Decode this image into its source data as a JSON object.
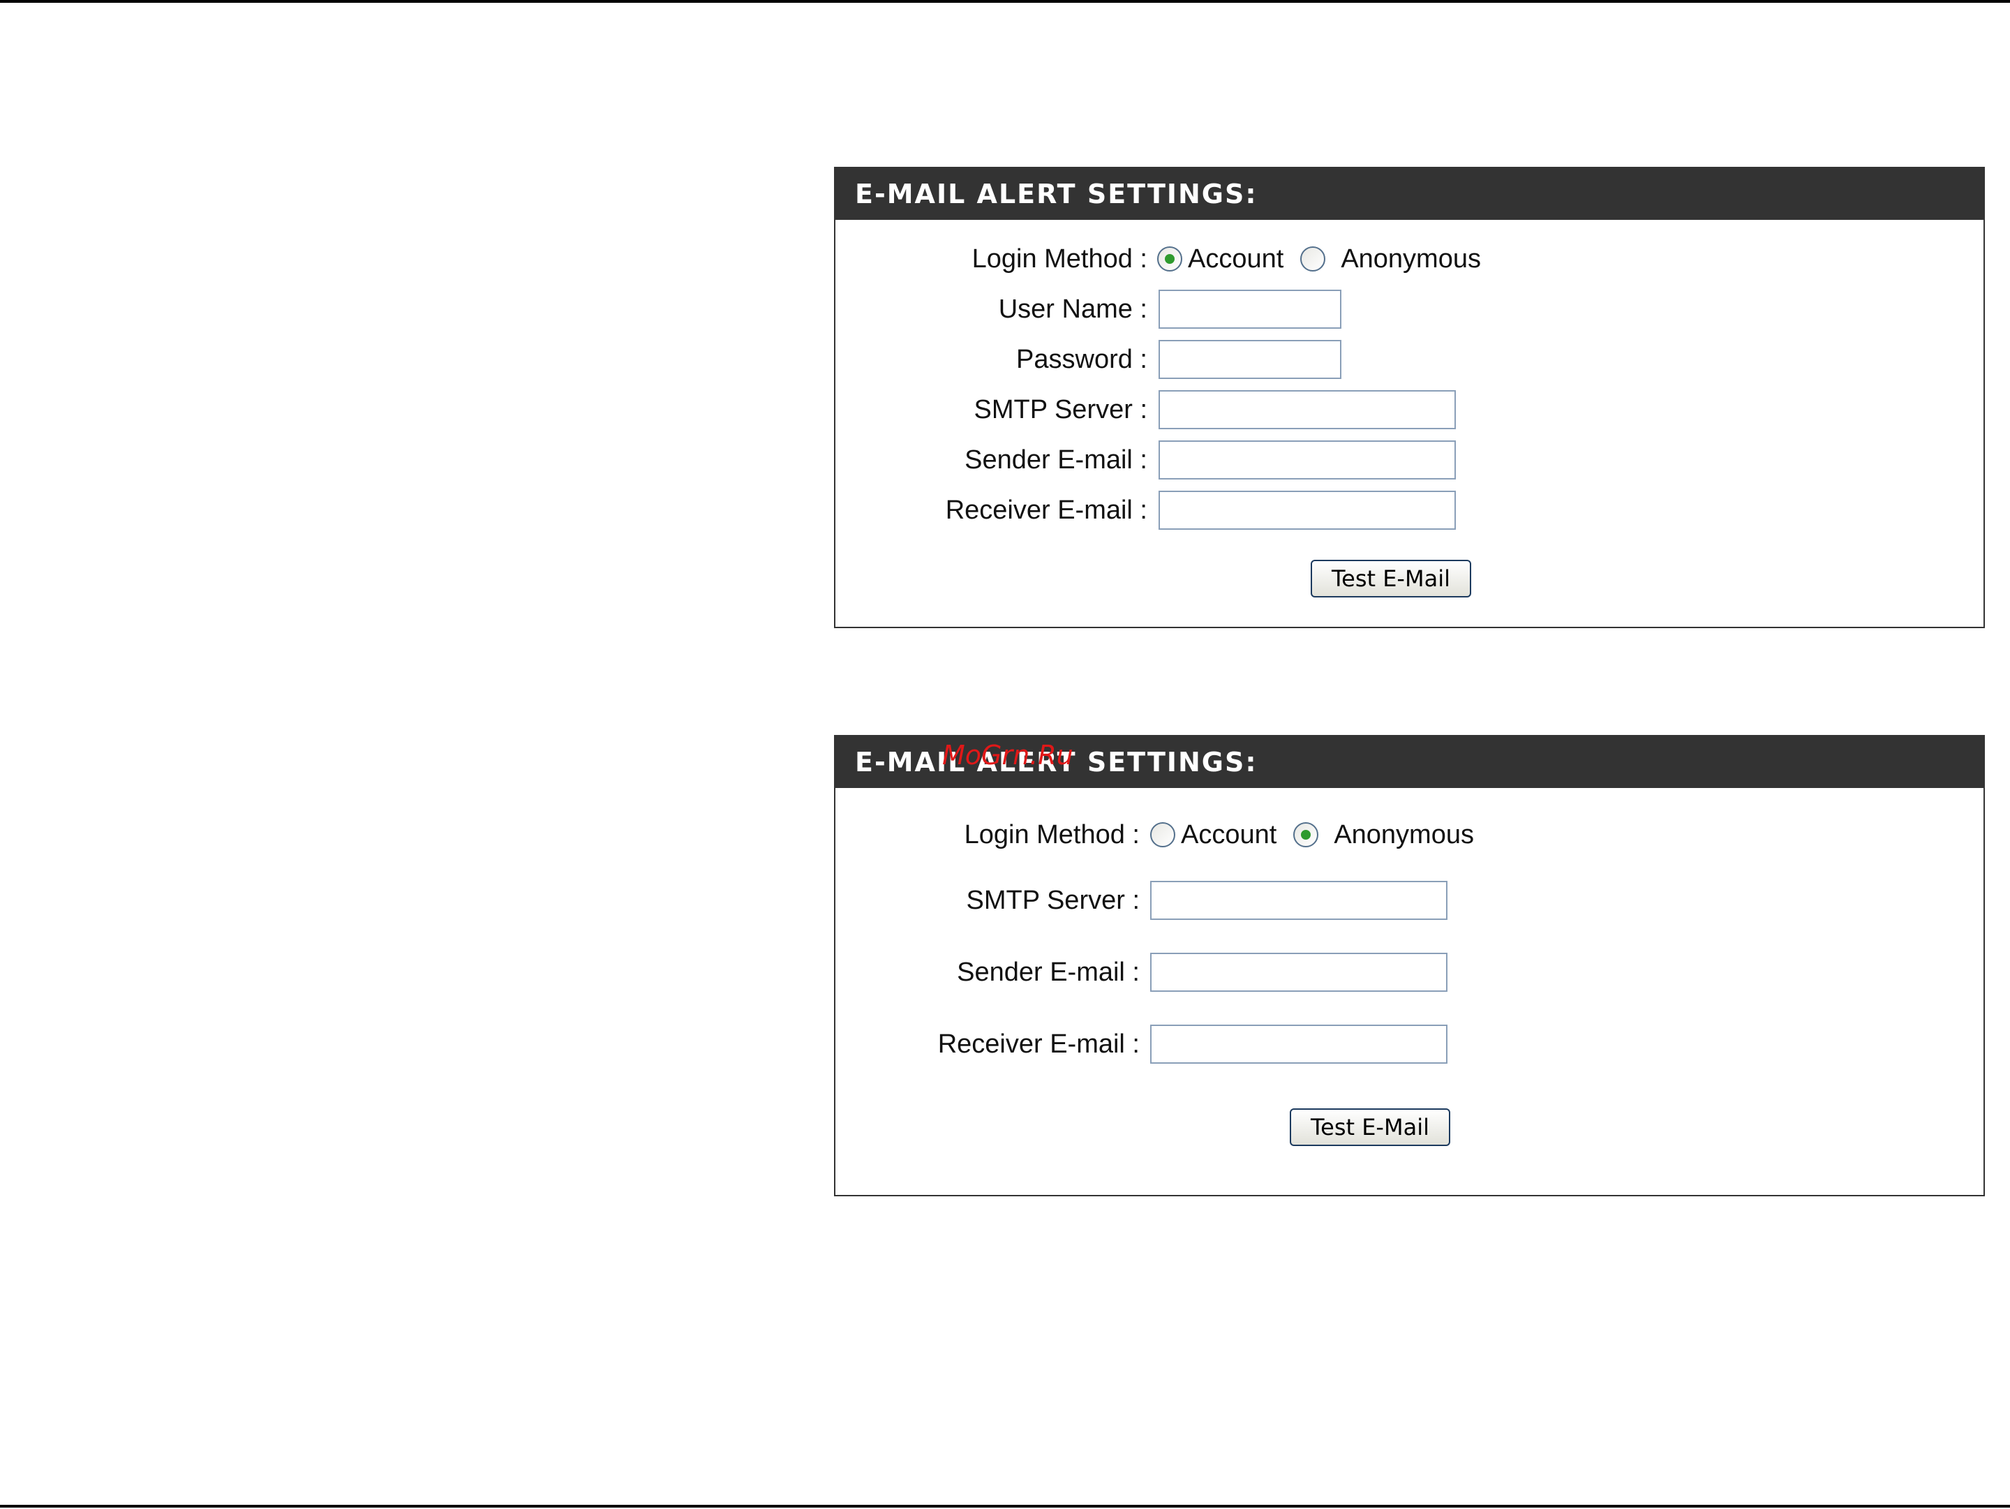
{
  "panels": [
    {
      "title": "E-MAIL ALERT SETTINGS:",
      "login_method_label": "Login Method :",
      "options": [
        {
          "label": "Account",
          "selected": true
        },
        {
          "label": "Anonymous",
          "selected": false
        }
      ],
      "fields": [
        {
          "label": "User Name :",
          "value": ""
        },
        {
          "label": "Password :",
          "value": ""
        },
        {
          "label": "SMTP Server :",
          "value": ""
        },
        {
          "label": "Sender E-mail :",
          "value": ""
        },
        {
          "label": "Receiver E-mail :",
          "value": ""
        }
      ],
      "button_label": "Test E-Mail"
    },
    {
      "title": "E-MAIL ALERT SETTINGS:",
      "login_method_label": "Login Method :",
      "options": [
        {
          "label": "Account",
          "selected": false
        },
        {
          "label": "Anonymous",
          "selected": true
        }
      ],
      "fields": [
        {
          "label": "SMTP Server :",
          "value": ""
        },
        {
          "label": "Sender E-mail :",
          "value": ""
        },
        {
          "label": "Receiver E-mail :",
          "value": ""
        }
      ],
      "button_label": "Test E-Mail"
    }
  ],
  "watermark": "MoGrn.Ru",
  "colors": {
    "header_bg": "#333333",
    "radio_selected": "#2e9a2e",
    "input_border": "#8a9fb8",
    "watermark": "#e01818"
  }
}
